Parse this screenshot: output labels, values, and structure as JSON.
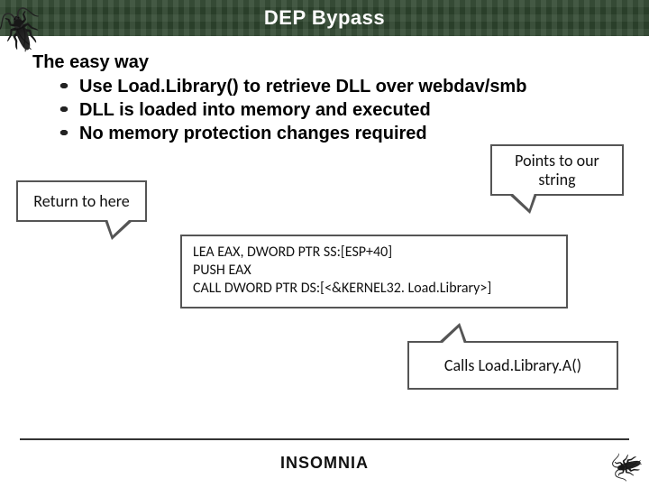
{
  "title": "DEP Bypass",
  "heading": "The easy way",
  "bullets": [
    "Use Load.Library() to retrieve DLL over webdav/smb",
    "DLL is loaded into memory and executed",
    "No memory protection changes required"
  ],
  "callouts": {
    "left": "Return to here",
    "right_line1": "Points to our",
    "right_line2": "string",
    "bottom": "Calls Load.Library.A()"
  },
  "code": {
    "line1": "LEA EAX, DWORD PTR SS:[ESP+40]",
    "line2": "PUSH EAX",
    "line3": "CALL DWORD PTR DS:[<&KERNEL32. Load.Library>]"
  },
  "footer": "INSOMNIA"
}
